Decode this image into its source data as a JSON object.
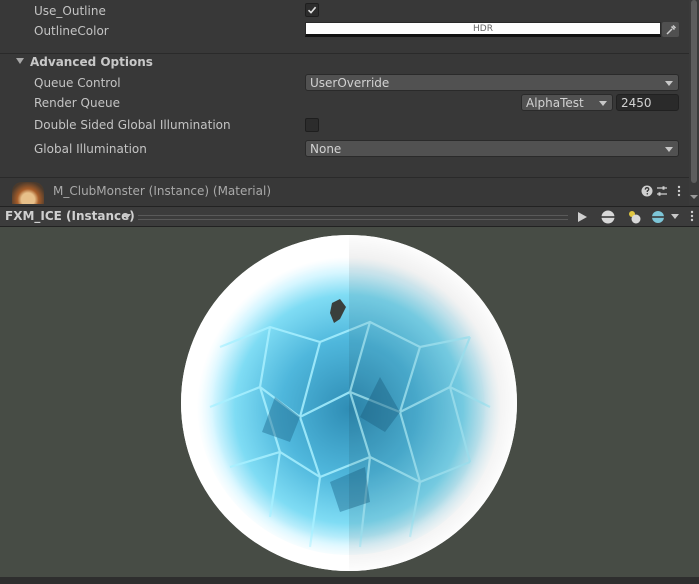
{
  "properties": {
    "use_outline": {
      "label": "Use_Outline",
      "checked": true
    },
    "outline_color": {
      "label": "OutlineColor",
      "value_text": "HDR",
      "color": "#ffffff"
    }
  },
  "advanced": {
    "header": "Advanced Options",
    "queue_control": {
      "label": "Queue Control",
      "value": "UserOverride"
    },
    "render_queue": {
      "label": "Render Queue",
      "preset": "AlphaTest",
      "value": "2450"
    },
    "double_sided_gi": {
      "label": "Double Sided Global Illumination",
      "checked": false
    },
    "global_illumination": {
      "label": "Global Illumination",
      "value": "None"
    }
  },
  "material": {
    "name": "M_ClubMonster (Instance) (Material)"
  },
  "preview": {
    "title": "FXM_ICE (Instance)"
  },
  "colors": {
    "panel": "#383838",
    "field": "#515151",
    "preview_bg": "#474c45",
    "ice": "#5fd0ee"
  }
}
